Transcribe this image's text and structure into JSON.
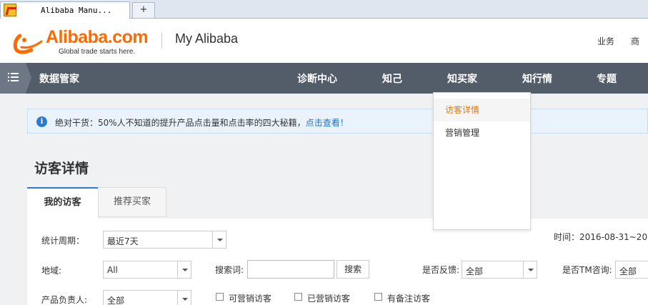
{
  "browser": {
    "tab_title": "Alibaba Manu...",
    "new_tab_label": "+"
  },
  "header": {
    "logo_text": "Alibaba.com",
    "logo_tagline": "Global trade starts here.",
    "section_title": "My Alibaba",
    "links": [
      "业务",
      "商"
    ]
  },
  "nav": {
    "brand": "数据管家",
    "items": [
      "诊断中心",
      "知己",
      "知买家",
      "知行情",
      "专题"
    ],
    "active_index": 2
  },
  "dropdown": {
    "items": [
      "访客详情",
      "营销管理"
    ],
    "active_index": 0
  },
  "notice": {
    "icon": "info-icon",
    "text": "绝对干货：50%人不知道的提升产品点击量和点击率的四大秘籍，",
    "link_text": "点击查看！"
  },
  "page": {
    "title": "访客详情",
    "tabs": [
      "我的访客",
      "推荐买家"
    ],
    "active_tab": 0
  },
  "filters": {
    "period_label": "统计周期：",
    "period_value": "最近7天",
    "time_label": "时间：",
    "time_value": "2016-08-31~20",
    "region_label": "地域:",
    "region_value": "All",
    "keyword_label": "搜索词:",
    "keyword_value": "",
    "search_button": "搜索",
    "feedback_label": "是否反馈:",
    "feedback_value": "全部",
    "tm_label": "是否TM咨询:",
    "tm_value": "全部",
    "owner_label": "产品负责人:",
    "owner_value": "全部",
    "checkboxes": [
      "可营销访客",
      "已营销访客",
      "有备注访客"
    ]
  },
  "colors": {
    "nav_bg": "#535c69",
    "accent_orange": "#ff6a00",
    "link_blue": "#1a74c8",
    "dropdown_active": "#e47911"
  }
}
